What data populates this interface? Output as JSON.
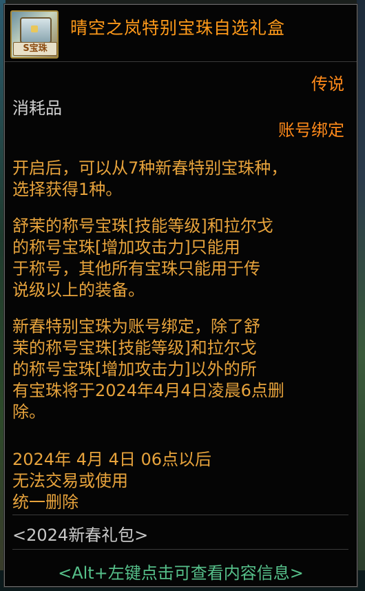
{
  "item": {
    "name": "晴空之岚特别宝珠自选礼盒",
    "icon_badge": "S宝珠",
    "icon": "gift-box-icon",
    "rarity": "传说",
    "category": "消耗品",
    "binding": "账号绑定"
  },
  "description": {
    "p1": "开启后，可以从7种新春特别宝珠种，\n选择获得1种。",
    "p2": "舒茉的称号宝珠[技能等级]和拉尔戈\n的称号宝珠[增加攻击力]只能用\n于称号，其他所有宝珠只能用于传\n说级以上的装备。",
    "p3": "新春特别宝珠为账号绑定，除了舒\n茉的称号宝珠[技能等级]和拉尔戈\n的称号宝珠[增加攻击力]以外的所\n有宝珠将于2024年4月4日凌晨6点删\n除。",
    "p4": "2024年 4月 4日 06点以后\n无法交易或使用\n统一删除"
  },
  "package_label": "<2024新春礼包>",
  "hint": "<Alt+左键点击可查看内容信息>",
  "colors": {
    "title": "#ff9a1a",
    "description": "#e7a33c",
    "hint": "#56c08a",
    "normal_text": "#d0d0d0"
  }
}
